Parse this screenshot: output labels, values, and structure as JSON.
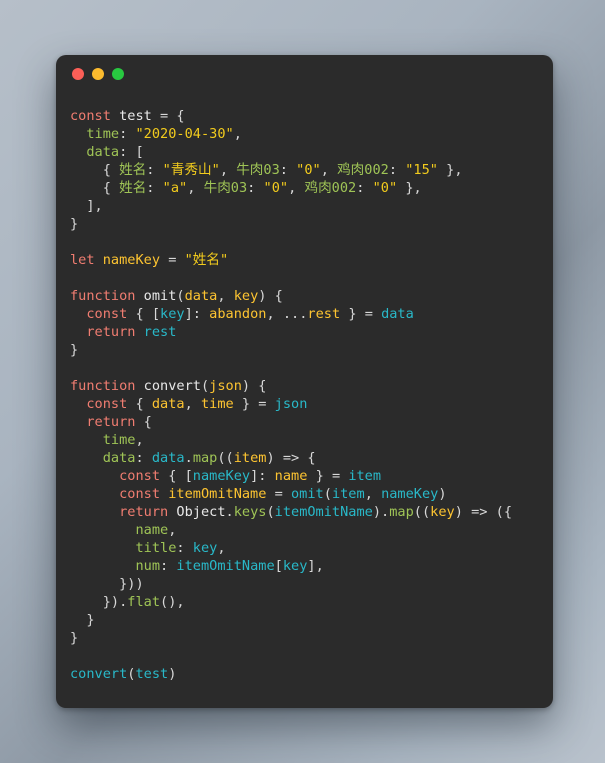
{
  "window": {
    "title": "",
    "controls": [
      {
        "name": "close",
        "color": "#fc5f57"
      },
      {
        "name": "minimize",
        "color": "#fcbb2e"
      },
      {
        "name": "maximize",
        "color": "#28c840"
      }
    ]
  },
  "editor": {
    "language": "javascript",
    "background": "#2b2b2b",
    "palette": {
      "keyword": "#f07d71",
      "function_name": "#e8e8e8",
      "variable": "#fdc431",
      "property_key": "#9fc456",
      "string": "#f2cb1d",
      "identifier": "#29b8c8",
      "punctuation": "#d8d8d8",
      "method": "#9fc456"
    },
    "plain_text": "const test = {\n  time: \"2020-04-30\",\n  data: [\n    { 姓名: \"青秀山\", 牛肉03: \"0\", 鸡肉002: \"15\" },\n    { 姓名: \"a\", 牛肉03: \"0\", 鸡肉002: \"0\" },\n  ],\n}\n\nlet nameKey = \"姓名\"\n\nfunction omit(data, key) {\n  const { [key]: abandon, ...rest } = data\n  return rest\n}\n\nfunction convert(json) {\n  const { data, time } = json\n  return {\n    time,\n    data: data.map((item) => {\n      const { [nameKey]: name } = item\n      const itemOmitName = omit(item, nameKey)\n      return Object.keys(itemOmitName).map((key) => ({\n        name,\n        title: key,\n        num: itemOmitName[key],\n      }))\n    }).flat(),\n  }\n}\n\nconvert(test)",
    "lines": [
      [
        {
          "t": "const ",
          "c": "kw"
        },
        {
          "t": "test",
          "c": "fn"
        },
        {
          "t": " = {",
          "c": "punc"
        }
      ],
      [
        {
          "t": "  ",
          "c": "plain"
        },
        {
          "t": "time",
          "c": "key"
        },
        {
          "t": ": ",
          "c": "punc"
        },
        {
          "t": "\"2020-04-30\"",
          "c": "str"
        },
        {
          "t": ",",
          "c": "punc"
        }
      ],
      [
        {
          "t": "  ",
          "c": "plain"
        },
        {
          "t": "data",
          "c": "key"
        },
        {
          "t": ": [",
          "c": "punc"
        }
      ],
      [
        {
          "t": "    { ",
          "c": "punc"
        },
        {
          "t": "姓名",
          "c": "key"
        },
        {
          "t": ": ",
          "c": "punc"
        },
        {
          "t": "\"青秀山\"",
          "c": "str"
        },
        {
          "t": ", ",
          "c": "punc"
        },
        {
          "t": "牛肉03",
          "c": "key"
        },
        {
          "t": ": ",
          "c": "punc"
        },
        {
          "t": "\"0\"",
          "c": "str"
        },
        {
          "t": ", ",
          "c": "punc"
        },
        {
          "t": "鸡肉002",
          "c": "key"
        },
        {
          "t": ": ",
          "c": "punc"
        },
        {
          "t": "\"15\"",
          "c": "str"
        },
        {
          "t": " },",
          "c": "punc"
        }
      ],
      [
        {
          "t": "    { ",
          "c": "punc"
        },
        {
          "t": "姓名",
          "c": "key"
        },
        {
          "t": ": ",
          "c": "punc"
        },
        {
          "t": "\"a\"",
          "c": "str"
        },
        {
          "t": ", ",
          "c": "punc"
        },
        {
          "t": "牛肉03",
          "c": "key"
        },
        {
          "t": ": ",
          "c": "punc"
        },
        {
          "t": "\"0\"",
          "c": "str"
        },
        {
          "t": ", ",
          "c": "punc"
        },
        {
          "t": "鸡肉002",
          "c": "key"
        },
        {
          "t": ": ",
          "c": "punc"
        },
        {
          "t": "\"0\"",
          "c": "str"
        },
        {
          "t": " },",
          "c": "punc"
        }
      ],
      [
        {
          "t": "  ],",
          "c": "punc"
        }
      ],
      [
        {
          "t": "}",
          "c": "punc"
        }
      ],
      [],
      [
        {
          "t": "let ",
          "c": "kw"
        },
        {
          "t": "nameKey",
          "c": "var"
        },
        {
          "t": " = ",
          "c": "punc"
        },
        {
          "t": "\"姓名\"",
          "c": "str"
        }
      ],
      [],
      [
        {
          "t": "function ",
          "c": "kw"
        },
        {
          "t": "omit",
          "c": "fn"
        },
        {
          "t": "(",
          "c": "punc"
        },
        {
          "t": "data",
          "c": "var"
        },
        {
          "t": ", ",
          "c": "punc"
        },
        {
          "t": "key",
          "c": "var"
        },
        {
          "t": ") {",
          "c": "punc"
        }
      ],
      [
        {
          "t": "  ",
          "c": "plain"
        },
        {
          "t": "const ",
          "c": "kw"
        },
        {
          "t": "{ [",
          "c": "punc"
        },
        {
          "t": "key",
          "c": "id"
        },
        {
          "t": "]: ",
          "c": "punc"
        },
        {
          "t": "abandon",
          "c": "var"
        },
        {
          "t": ", ...",
          "c": "punc"
        },
        {
          "t": "rest",
          "c": "var"
        },
        {
          "t": " } = ",
          "c": "punc"
        },
        {
          "t": "data",
          "c": "id"
        }
      ],
      [
        {
          "t": "  ",
          "c": "plain"
        },
        {
          "t": "return ",
          "c": "kw"
        },
        {
          "t": "rest",
          "c": "id"
        }
      ],
      [
        {
          "t": "}",
          "c": "punc"
        }
      ],
      [],
      [
        {
          "t": "function ",
          "c": "kw"
        },
        {
          "t": "convert",
          "c": "fn"
        },
        {
          "t": "(",
          "c": "punc"
        },
        {
          "t": "json",
          "c": "var"
        },
        {
          "t": ") {",
          "c": "punc"
        }
      ],
      [
        {
          "t": "  ",
          "c": "plain"
        },
        {
          "t": "const ",
          "c": "kw"
        },
        {
          "t": "{ ",
          "c": "punc"
        },
        {
          "t": "data",
          "c": "var"
        },
        {
          "t": ", ",
          "c": "punc"
        },
        {
          "t": "time",
          "c": "var"
        },
        {
          "t": " } = ",
          "c": "punc"
        },
        {
          "t": "json",
          "c": "id"
        }
      ],
      [
        {
          "t": "  ",
          "c": "plain"
        },
        {
          "t": "return ",
          "c": "kw"
        },
        {
          "t": "{",
          "c": "punc"
        }
      ],
      [
        {
          "t": "    ",
          "c": "plain"
        },
        {
          "t": "time",
          "c": "key"
        },
        {
          "t": ",",
          "c": "punc"
        }
      ],
      [
        {
          "t": "    ",
          "c": "plain"
        },
        {
          "t": "data",
          "c": "key"
        },
        {
          "t": ": ",
          "c": "punc"
        },
        {
          "t": "data",
          "c": "id"
        },
        {
          "t": ".",
          "c": "punc"
        },
        {
          "t": "map",
          "c": "meth"
        },
        {
          "t": "((",
          "c": "punc"
        },
        {
          "t": "item",
          "c": "var"
        },
        {
          "t": ") => {",
          "c": "punc"
        }
      ],
      [
        {
          "t": "      ",
          "c": "plain"
        },
        {
          "t": "const ",
          "c": "kw"
        },
        {
          "t": "{ [",
          "c": "punc"
        },
        {
          "t": "nameKey",
          "c": "id"
        },
        {
          "t": "]: ",
          "c": "punc"
        },
        {
          "t": "name",
          "c": "var"
        },
        {
          "t": " } = ",
          "c": "punc"
        },
        {
          "t": "item",
          "c": "id"
        }
      ],
      [
        {
          "t": "      ",
          "c": "plain"
        },
        {
          "t": "const ",
          "c": "kw"
        },
        {
          "t": "itemOmitName",
          "c": "var"
        },
        {
          "t": " = ",
          "c": "punc"
        },
        {
          "t": "omit",
          "c": "id"
        },
        {
          "t": "(",
          "c": "punc"
        },
        {
          "t": "item",
          "c": "id"
        },
        {
          "t": ", ",
          "c": "punc"
        },
        {
          "t": "nameKey",
          "c": "id"
        },
        {
          "t": ")",
          "c": "punc"
        }
      ],
      [
        {
          "t": "      ",
          "c": "plain"
        },
        {
          "t": "return ",
          "c": "kw"
        },
        {
          "t": "Object",
          "c": "fn"
        },
        {
          "t": ".",
          "c": "punc"
        },
        {
          "t": "keys",
          "c": "meth"
        },
        {
          "t": "(",
          "c": "punc"
        },
        {
          "t": "itemOmitName",
          "c": "id"
        },
        {
          "t": ").",
          "c": "punc"
        },
        {
          "t": "map",
          "c": "meth"
        },
        {
          "t": "((",
          "c": "punc"
        },
        {
          "t": "key",
          "c": "var"
        },
        {
          "t": ") => ({",
          "c": "punc"
        }
      ],
      [
        {
          "t": "        ",
          "c": "plain"
        },
        {
          "t": "name",
          "c": "key"
        },
        {
          "t": ",",
          "c": "punc"
        }
      ],
      [
        {
          "t": "        ",
          "c": "plain"
        },
        {
          "t": "title",
          "c": "key"
        },
        {
          "t": ": ",
          "c": "punc"
        },
        {
          "t": "key",
          "c": "id"
        },
        {
          "t": ",",
          "c": "punc"
        }
      ],
      [
        {
          "t": "        ",
          "c": "plain"
        },
        {
          "t": "num",
          "c": "key"
        },
        {
          "t": ": ",
          "c": "punc"
        },
        {
          "t": "itemOmitName",
          "c": "id"
        },
        {
          "t": "[",
          "c": "punc"
        },
        {
          "t": "key",
          "c": "id"
        },
        {
          "t": "],",
          "c": "punc"
        }
      ],
      [
        {
          "t": "      }))",
          "c": "punc"
        }
      ],
      [
        {
          "t": "    }).",
          "c": "punc"
        },
        {
          "t": "flat",
          "c": "meth"
        },
        {
          "t": "(),",
          "c": "punc"
        }
      ],
      [
        {
          "t": "  }",
          "c": "punc"
        }
      ],
      [
        {
          "t": "}",
          "c": "punc"
        }
      ],
      [],
      [
        {
          "t": "convert",
          "c": "id"
        },
        {
          "t": "(",
          "c": "punc"
        },
        {
          "t": "test",
          "c": "id"
        },
        {
          "t": ")",
          "c": "punc"
        }
      ]
    ]
  }
}
